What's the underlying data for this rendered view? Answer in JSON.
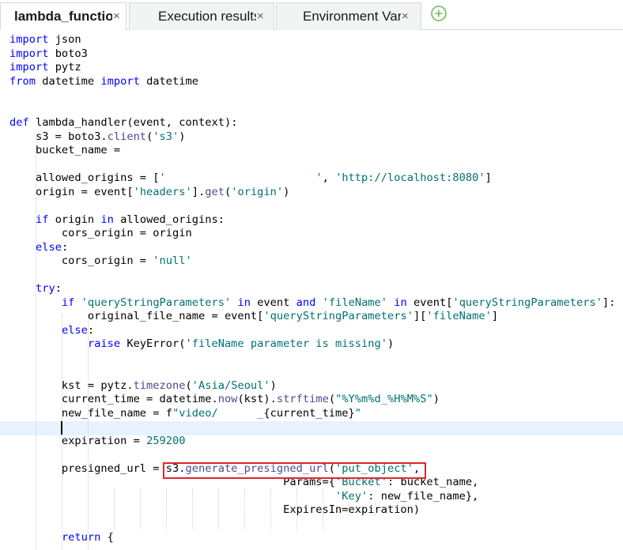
{
  "tabs": [
    {
      "label": "lambda_function",
      "close": "×",
      "active": true
    },
    {
      "label": "Execution results",
      "close": "×",
      "active": false
    },
    {
      "label": "Environment Vari",
      "close": "×",
      "active": false
    }
  ],
  "add_tab_icon": "plus-circle-icon",
  "colors": {
    "keyword": "#0000ff",
    "string": "#007171",
    "highlight_box": "#e0262b",
    "active_line": "#e8f2fe",
    "add_icon": "#6bbf59"
  },
  "code": {
    "lines": [
      {
        "segments": [
          {
            "t": "import",
            "c": "kw"
          },
          {
            "t": " json",
            "c": ""
          }
        ]
      },
      {
        "segments": [
          {
            "t": "import",
            "c": "kw"
          },
          {
            "t": " boto3",
            "c": ""
          }
        ]
      },
      {
        "segments": [
          {
            "t": "import",
            "c": "kw"
          },
          {
            "t": " pytz",
            "c": ""
          }
        ]
      },
      {
        "segments": [
          {
            "t": "from",
            "c": "kw"
          },
          {
            "t": " datetime ",
            "c": ""
          },
          {
            "t": "import",
            "c": "kw"
          },
          {
            "t": " datetime",
            "c": ""
          }
        ]
      },
      {
        "segments": []
      },
      {
        "segments": []
      },
      {
        "segments": [
          {
            "t": "def",
            "c": "kw"
          },
          {
            "t": " lambda_handler(event, context):",
            "c": ""
          }
        ]
      },
      {
        "segments": [
          {
            "t": "    s3 = boto3.",
            "c": ""
          },
          {
            "t": "client",
            "c": "call"
          },
          {
            "t": "(",
            "c": ""
          },
          {
            "t": "'s3'",
            "c": "str"
          },
          {
            "t": ")",
            "c": ""
          }
        ]
      },
      {
        "segments": [
          {
            "t": "    bucket_name = ",
            "c": ""
          }
        ]
      },
      {
        "segments": []
      },
      {
        "segments": [
          {
            "t": "    allowed_origins = [",
            "c": ""
          },
          {
            "t": "'",
            "c": "str"
          },
          {
            "t": "                       ",
            "c": ""
          },
          {
            "t": "'",
            "c": "str"
          },
          {
            "t": ", ",
            "c": ""
          },
          {
            "t": "'http://localhost:8080'",
            "c": "str"
          },
          {
            "t": "]",
            "c": ""
          }
        ]
      },
      {
        "segments": [
          {
            "t": "    origin = event[",
            "c": ""
          },
          {
            "t": "'headers'",
            "c": "str"
          },
          {
            "t": "].",
            "c": ""
          },
          {
            "t": "get",
            "c": "call"
          },
          {
            "t": "(",
            "c": ""
          },
          {
            "t": "'origin'",
            "c": "str"
          },
          {
            "t": ")",
            "c": ""
          }
        ]
      },
      {
        "segments": []
      },
      {
        "segments": [
          {
            "t": "    ",
            "c": ""
          },
          {
            "t": "if",
            "c": "kw"
          },
          {
            "t": " origin ",
            "c": ""
          },
          {
            "t": "in",
            "c": "kw"
          },
          {
            "t": " allowed_origins:",
            "c": ""
          }
        ]
      },
      {
        "segments": [
          {
            "t": "        cors_origin = origin",
            "c": ""
          }
        ]
      },
      {
        "segments": [
          {
            "t": "    ",
            "c": ""
          },
          {
            "t": "else",
            "c": "kw"
          },
          {
            "t": ":",
            "c": ""
          }
        ]
      },
      {
        "segments": [
          {
            "t": "        cors_origin = ",
            "c": ""
          },
          {
            "t": "'null'",
            "c": "str"
          }
        ]
      },
      {
        "segments": []
      },
      {
        "segments": [
          {
            "t": "    ",
            "c": ""
          },
          {
            "t": "try",
            "c": "kw"
          },
          {
            "t": ":",
            "c": ""
          }
        ]
      },
      {
        "segments": [
          {
            "t": "        ",
            "c": ""
          },
          {
            "t": "if",
            "c": "kw"
          },
          {
            "t": " ",
            "c": ""
          },
          {
            "t": "'queryStringParameters'",
            "c": "str"
          },
          {
            "t": " ",
            "c": ""
          },
          {
            "t": "in",
            "c": "kw"
          },
          {
            "t": " event ",
            "c": ""
          },
          {
            "t": "and",
            "c": "kw"
          },
          {
            "t": " ",
            "c": ""
          },
          {
            "t": "'fileName'",
            "c": "str"
          },
          {
            "t": " ",
            "c": ""
          },
          {
            "t": "in",
            "c": "kw"
          },
          {
            "t": " event[",
            "c": ""
          },
          {
            "t": "'queryStringParameters'",
            "c": "str"
          },
          {
            "t": "]:",
            "c": ""
          }
        ]
      },
      {
        "segments": [
          {
            "t": "            original_file_name = event[",
            "c": ""
          },
          {
            "t": "'queryStringParameters'",
            "c": "str"
          },
          {
            "t": "][",
            "c": ""
          },
          {
            "t": "'fileName'",
            "c": "str"
          },
          {
            "t": "]",
            "c": ""
          }
        ]
      },
      {
        "segments": [
          {
            "t": "        ",
            "c": ""
          },
          {
            "t": "else",
            "c": "kw"
          },
          {
            "t": ":",
            "c": ""
          }
        ]
      },
      {
        "segments": [
          {
            "t": "            ",
            "c": ""
          },
          {
            "t": "raise",
            "c": "kw"
          },
          {
            "t": " KeyError(",
            "c": ""
          },
          {
            "t": "'fileName parameter is missing'",
            "c": "str"
          },
          {
            "t": ")",
            "c": ""
          }
        ]
      },
      {
        "segments": []
      },
      {
        "segments": []
      },
      {
        "segments": [
          {
            "t": "        kst = pytz.",
            "c": ""
          },
          {
            "t": "timezone",
            "c": "call"
          },
          {
            "t": "(",
            "c": ""
          },
          {
            "t": "'Asia/Seoul'",
            "c": "str"
          },
          {
            "t": ")",
            "c": ""
          }
        ]
      },
      {
        "segments": [
          {
            "t": "        current_time = datetime.",
            "c": ""
          },
          {
            "t": "now",
            "c": "call"
          },
          {
            "t": "(kst).",
            "c": ""
          },
          {
            "t": "strftime",
            "c": "call"
          },
          {
            "t": "(",
            "c": ""
          },
          {
            "t": "\"%Y%m%d_%H%M%S\"",
            "c": "str"
          },
          {
            "t": ")",
            "c": ""
          }
        ]
      },
      {
        "segments": [
          {
            "t": "        new_file_name = f",
            "c": ""
          },
          {
            "t": "\"video/",
            "c": "str"
          },
          {
            "t": "      ",
            "c": ""
          },
          {
            "t": "_",
            "c": "str"
          },
          {
            "t": "{current_time}",
            "c": ""
          },
          {
            "t": "\"",
            "c": "str"
          }
        ]
      },
      {
        "segments": []
      },
      {
        "segments": [
          {
            "t": "        expiration = ",
            "c": ""
          },
          {
            "t": "259200",
            "c": "num"
          }
        ]
      },
      {
        "segments": []
      },
      {
        "segments": [
          {
            "t": "        presigned_url = s3.",
            "c": ""
          },
          {
            "t": "generate_presigned_url",
            "c": "call"
          },
          {
            "t": "(",
            "c": ""
          },
          {
            "t": "'put_object'",
            "c": "str"
          },
          {
            "t": ",",
            "c": ""
          }
        ]
      },
      {
        "segments": [
          {
            "t": "                                          Params={",
            "c": ""
          },
          {
            "t": "'Bucket'",
            "c": "str"
          },
          {
            "t": ": bucket_name,",
            "c": ""
          }
        ]
      },
      {
        "segments": [
          {
            "t": "                                                  ",
            "c": ""
          },
          {
            "t": "'Key'",
            "c": "str"
          },
          {
            "t": ": new_file_name},",
            "c": ""
          }
        ]
      },
      {
        "segments": [
          {
            "t": "                                          ExpiresIn=expiration)",
            "c": ""
          }
        ]
      },
      {
        "segments": []
      },
      {
        "segments": [
          {
            "t": "        ",
            "c": ""
          },
          {
            "t": "return",
            "c": "kw"
          },
          {
            "t": " {",
            "c": ""
          }
        ]
      }
    ]
  }
}
